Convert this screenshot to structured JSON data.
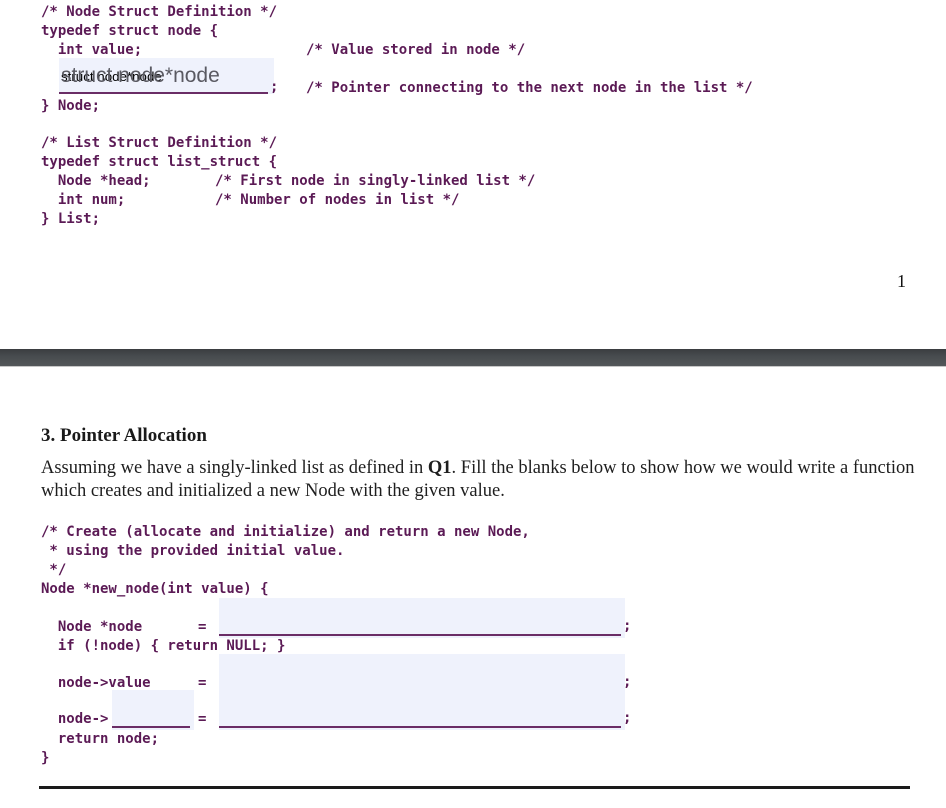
{
  "page1": {
    "node_struct": {
      "comment_title": "/* Node Struct Definition */",
      "typedef_line": "typedef struct node {",
      "value_field": "  int value;",
      "value_comment": "/* Value stored in node */",
      "next_field_answer": "struct node*node",
      "next_field_semicolon": ";",
      "next_comment": "/* Pointer connecting to the next node in the list */",
      "close_line": "} Node;"
    },
    "list_struct": {
      "comment_title": "/* List Struct Definition */",
      "typedef_line": "typedef struct list_struct {",
      "head_field": "  Node *head;",
      "head_comment": "/* First node in singly-linked list */",
      "num_field": "  int num;",
      "num_comment": "/* Number of nodes in list */",
      "close_line": "} List;"
    },
    "page_number": "1"
  },
  "page2": {
    "heading": "3. Pointer Allocation",
    "paragraph_before_bold": "Assuming we have a singly-linked list as defined in ",
    "paragraph_bold": "Q1",
    "paragraph_after_bold": ". Fill the blanks below to show how we would write a function which creates and initialized a new Node with the given value.",
    "code": {
      "comment_line1": "/* Create (allocate and initialize) and return a new Node,",
      "comment_line2": " * using the provided initial value.",
      "comment_line3": " */",
      "signature": "Node *new_node(int value) {",
      "alloc_lhs": "  Node *node",
      "equals": "=",
      "semicolon": ";",
      "null_check": "  if (!node) { return NULL; }",
      "value_lhs": "  node->value",
      "next_lhs": "  node->",
      "return_line": "  return node;",
      "close_brace": "}"
    },
    "blanks": {
      "alloc_value": "",
      "value_assign": "",
      "member_name": "",
      "member_assign": ""
    }
  }
}
